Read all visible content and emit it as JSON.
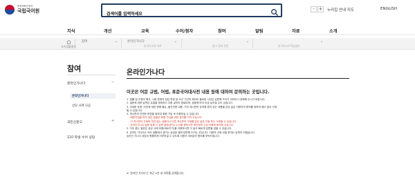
{
  "header": {
    "logo_sub": "문화체육관광부",
    "logo_main": "국립국어원",
    "search_placeholder": "검색어를 입력하세요",
    "zoom_minus": "-",
    "zoom_plus": "+",
    "guide_label": "누리집 안내 지도",
    "language_label": "ENGLISH"
  },
  "gnb": [
    "지식",
    "개선",
    "교육",
    "수어/점자",
    "참여",
    "알림",
    "자료",
    "소개"
  ],
  "breadcrumb": {
    "home_label": "홈",
    "home_sub": "국어생활종합",
    "items": [
      {
        "label": "참여",
        "sub": ""
      },
      {
        "label": "온라인가나다",
        "sub": "한국어교육 자료"
      },
      {
        "label": "",
        "sub": "참고 질의 전문"
      },
      {
        "label": "",
        "sub": "한국어교수학습샘터"
      }
    ]
  },
  "sidebar": {
    "title": "참여",
    "items": [
      {
        "label": "온라인가나다",
        "children": [
          "온라인가나다",
          "상담 사례 모음"
        ]
      },
      {
        "label": "국민신문고",
        "children": []
      },
      {
        "label": "110 학생 수어 상담",
        "children": []
      }
    ]
  },
  "main": {
    "title": "온라인가나다",
    "intro": "이곳은 어문 규범, 어법, 표준국어대사전 내용 등에 대하여 문의하는 곳입니다.",
    "notes": [
      {
        "text": "1. 법률 및 규정의 해석, 시험 문제의 정답 판정 등 소관 기관의 해석이 필요한 사안은 답변해 드리기 어려우니 양해해 주시기 바랍니다.",
        "red": false
      },
      {
        "text": "2. 질문에 대한 답변은 유일을 제외하고 다음 날까지 완료되며, 상황에 따라 조금 늦어질 수도 있습니다.",
        "red": false
      },
      {
        "text": "3. 자세한 표현, 타인에 대한 명예 훼손, 불건전한 내용, 기타 게시판의 성격에 맞지 않는 내용을 담은 글은 이용자의 편의를 위하여 예고 없이 삭제",
        "red": false
      },
      {
        "text": "될 수 있습니다.",
        "red": false
      },
      {
        "text": "4. 게시판의 건전한 운영을 위하여 회원 가입 후 이용하실 수 있습니다.",
        "red": false
      },
      {
        "text": "- 회원가입을 하지 않은 분들은 회원 가입을 위한 절차를 거쳐 주십시오.",
        "red": true
      },
      {
        "text": "- 이 게시판의 주제와 관련 없는 내용이나 다른 게시판의 주제를 담은 글은 이동 또는 삭제될 수 있습니다.",
        "red": true
      },
      {
        "text": "- 온라인가나다 질문 등록 시 답변 알림(문자) 수신을 원하시면 개인정보 수집·이용에 동의해 주십시오.",
        "red": true
      },
      {
        "text": "5. 자주 묻는 질문은 상담 사례 모음(바로가기)을 이용하시면 더 쉽고 빠르게 답변을 찾을 수 있습니다.",
        "red": false
      },
      {
        "text": "6. 온라인 가나다는 국어 생활에서 생기는 궁금한 점에 답변해 드리는 곳입니다. 다량의 교정·교열 문의는 답변이 어렵습니다.",
        "red": false
      },
      {
        "text": "   온라인 가나다 상담이 원활하게 이루어질 수 있도록 이용자 여러분의 협조를 부탁드립니다.",
        "red": false
      }
    ],
    "footer_note": "※ '온라인 가나다'는 최근 2년 내 자료를 공개합니다."
  }
}
